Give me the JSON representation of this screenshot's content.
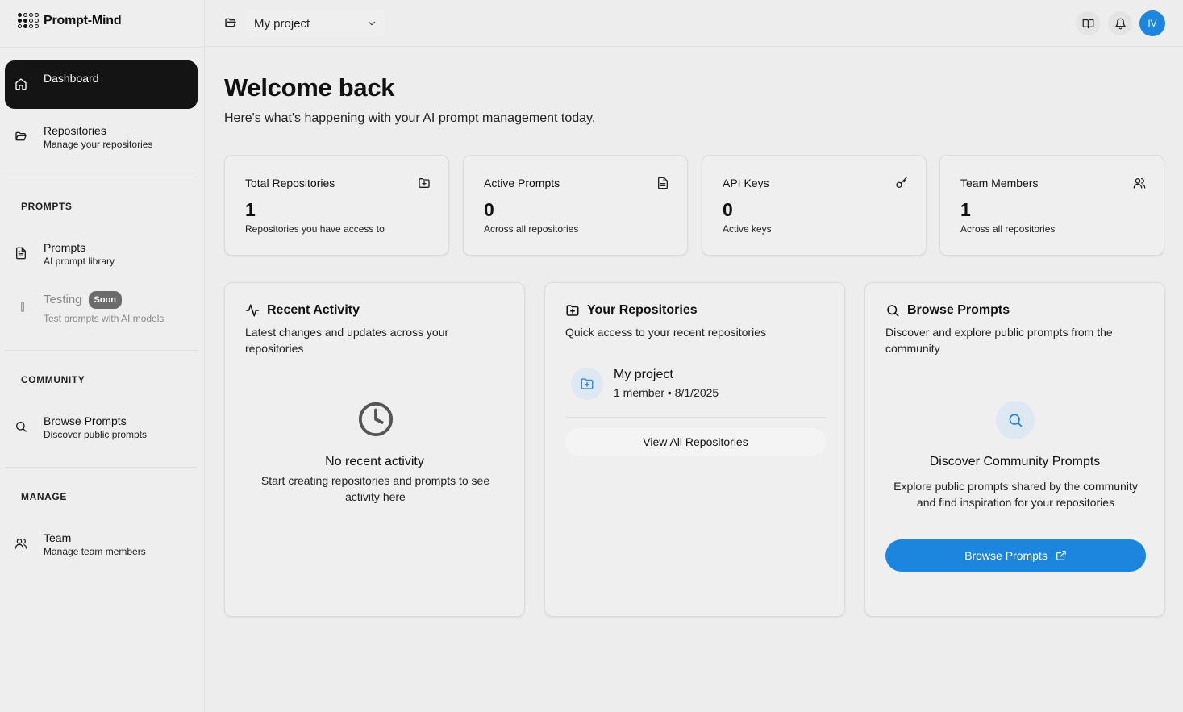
{
  "app": {
    "logo_text": "Prompt-Mind"
  },
  "sidebar": {
    "dashboard": {
      "title": "Dashboard",
      "icon": "home-icon"
    },
    "repositories": {
      "title": "Repositories",
      "subtitle": "Manage your repositories",
      "icon": "folder-open-icon"
    },
    "sections": {
      "prompts": "PROMPTS",
      "community": "COMMUNITY",
      "manage": "MANAGE"
    },
    "prompts": {
      "title": "Prompts",
      "subtitle": "AI prompt library",
      "icon": "document-icon"
    },
    "testing": {
      "title": "Testing",
      "badge": "Soon",
      "subtitle": "Test prompts with AI models",
      "icon": "test-tube-icon"
    },
    "browse": {
      "title": "Browse Prompts",
      "subtitle": "Discover public prompts",
      "icon": "search-icon"
    },
    "team": {
      "title": "Team",
      "subtitle": "Manage team members",
      "icon": "users-icon"
    }
  },
  "topbar": {
    "project_selected": "My project",
    "avatar_initials": "IV"
  },
  "main": {
    "title": "Welcome back",
    "subtitle": "Here's what's happening with your AI prompt management today.",
    "stats": [
      {
        "title": "Total Repositories",
        "value": "1",
        "subtitle": "Repositories you have access to",
        "icon": "folder-plus-icon"
      },
      {
        "title": "Active Prompts",
        "value": "0",
        "subtitle": "Across all repositories",
        "icon": "document-icon"
      },
      {
        "title": "API Keys",
        "value": "0",
        "subtitle": "Active keys",
        "icon": "key-icon"
      },
      {
        "title": "Team Members",
        "value": "1",
        "subtitle": "Across all repositories",
        "icon": "users-icon"
      }
    ],
    "recent_activity": {
      "title": "Recent Activity",
      "description": "Latest changes and updates across your repositories",
      "empty_title": "No recent activity",
      "empty_subtitle": "Start creating repositories and prompts to see activity here"
    },
    "your_repositories": {
      "title": "Your Repositories",
      "description": "Quick access to your recent repositories",
      "repo_name": "My project",
      "repo_meta": "1 member • 8/1/2025",
      "view_all_label": "View All Repositories"
    },
    "browse_prompts": {
      "title": "Browse Prompts",
      "description": "Discover and explore public prompts from the community",
      "discover_title": "Discover Community Prompts",
      "discover_subtitle": "Explore public prompts shared by the community and find inspiration for your repositories",
      "button_label": "Browse Prompts"
    }
  },
  "colors": {
    "accent": "#1c86de",
    "active_nav": "#141414"
  }
}
